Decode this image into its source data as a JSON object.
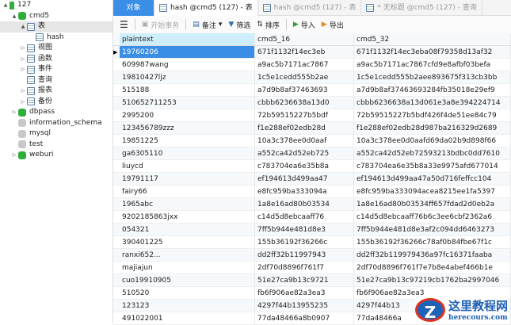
{
  "sidebar": {
    "items": [
      {
        "label": "127",
        "level": 0,
        "icon": "server-icon",
        "arrow": "▲"
      },
      {
        "label": "cmd5",
        "level": 1,
        "icon": "database-icon",
        "arrow": "▲"
      },
      {
        "label": "表",
        "level": 2,
        "icon": "table-icon",
        "arrow": "▲",
        "selected": true
      },
      {
        "label": "hash",
        "level": 3,
        "icon": "table-icon",
        "arrow": ""
      },
      {
        "label": "视图",
        "level": 2,
        "icon": "view-icon",
        "arrow": "▷"
      },
      {
        "label": "函数",
        "level": 2,
        "icon": "function-icon",
        "arrow": "▷"
      },
      {
        "label": "事件",
        "level": 2,
        "icon": "event-icon",
        "arrow": "▷"
      },
      {
        "label": "查询",
        "level": 2,
        "icon": "query-icon",
        "arrow": ""
      },
      {
        "label": "报表",
        "level": 2,
        "icon": "report-icon",
        "arrow": "▷"
      },
      {
        "label": "备份",
        "level": 2,
        "icon": "backup-icon",
        "arrow": "▷"
      },
      {
        "label": "dbpass",
        "level": 1,
        "icon": "database-icon",
        "arrow": "▷"
      },
      {
        "label": "information_schema",
        "level": 1,
        "icon": "database-gray-icon",
        "arrow": ""
      },
      {
        "label": "mysql",
        "level": 1,
        "icon": "database-gray-icon",
        "arrow": ""
      },
      {
        "label": "test",
        "level": 1,
        "icon": "database-gray-icon",
        "arrow": ""
      },
      {
        "label": "weburi",
        "level": 1,
        "icon": "database-icon",
        "arrow": "▷"
      }
    ]
  },
  "tabs": [
    "对象",
    "hash @cmd5 (127) - 表",
    "hash @cmd5 (127) - 表",
    "* 无标题 @cmd5 (127) - 查询"
  ],
  "toolbar": {
    "menu": "☰",
    "begin_tx": "开始事务",
    "note": "备注",
    "filter": "筛选",
    "sort": "排序",
    "import": "导入",
    "export": "导出"
  },
  "grid": {
    "columns": [
      "plaintext",
      "cmd5_16",
      "cmd5_32"
    ],
    "rows": [
      [
        "19760206",
        "671f1132f14ec3eb",
        "671f1132f14ec3eba08f79358d13af32"
      ],
      [
        "609987wang",
        "a9ac5b7171ac7867",
        "a9ac5b7171ac7867cfd9e8afbf03befa"
      ],
      [
        "19810427ljz",
        "1c5e1cedd555b2ae",
        "1c5e1cedd555b2aee893675f313cb3bb"
      ],
      [
        "515188",
        "a7d9b8af37463693",
        "a7d9b8af37463693284fb35018e29ef9"
      ],
      [
        "510652711253",
        "cbbb6236638a13d0",
        "cbbb6236638a13d061e3a8e394224714"
      ],
      [
        "2995200",
        "72b59515227b5bdf",
        "72b59515227b5bdf426f4de51ee84c79"
      ],
      [
        "123456789zzz",
        "f1e288ef02edb28d",
        "f1e288ef02edb28d987ba216329d2689"
      ],
      [
        "19851225",
        "10a3c378ee0d0aaf",
        "10a3c378ee0d0aafd69da02b9d898f66"
      ],
      [
        "ga6305110",
        "a552ca42d52eb725",
        "a552ca42d52eb72593213bdbc0dd7610"
      ],
      [
        "liuycd",
        "c783704ea6e35b8a",
        "c783704ea6e35b8a33e9975afd677014"
      ],
      [
        "19791117",
        "ef194613d499aa47",
        "ef194613d499aa47a50d716feffcc104"
      ],
      [
        "fairy66",
        "e8fc959ba333094a",
        "e8fc959ba333094acea8215ee1fa5397"
      ],
      [
        "1965abc",
        "1a8e16ad80b03534",
        "1a8e16ad80b03534ff657fdad2d0eb2a"
      ],
      [
        "9202185863jxx",
        "c14d5d8ebcaaff76",
        "c14d5d8ebcaaff76b6c3ee6cbf2362a6"
      ],
      [
        "054321",
        "7ff5b944e481d8e3",
        "7ff5b944e481d8e3af2c094dd6463273"
      ],
      [
        "390401225",
        "155b36192f36266c",
        "155b36192f36266c78af0b84fbe67f1c"
      ],
      [
        "ranxi652...",
        "dd2ff32b11997943",
        "dd2ff32b119979436a97fc16371faaba"
      ],
      [
        "majiajun",
        "2df70d8896f761f7",
        "2df70d8896f761f7e7b8e4abef466b1e"
      ],
      [
        "cuo19910905",
        "51e27ca9b13c9721",
        "51e27ca9b13c97219cb1762ba2997046"
      ],
      [
        "510520",
        "fb6f906ae82a3ea3",
        "fb6f906ae82a3ea3"
      ],
      [
        "123123",
        "4297f44b13955235",
        "4297f44b13"
      ],
      [
        "491022001",
        "77da48466a8b0907",
        "77da48466a"
      ]
    ]
  },
  "watermark": {
    "title": "这里教程网",
    "url": "herecours.com"
  }
}
